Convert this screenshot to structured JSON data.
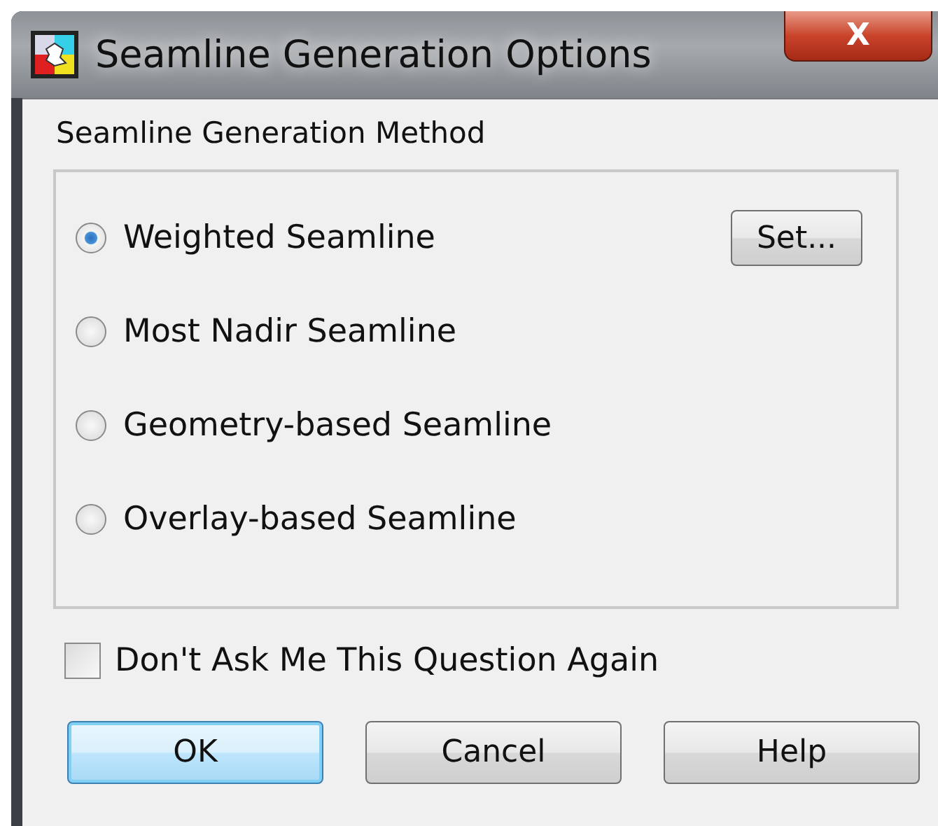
{
  "window": {
    "title": "Seamline Generation Options",
    "close_icon": "X"
  },
  "group": {
    "label": "Seamline Generation Method",
    "options": [
      {
        "label": "Weighted Seamline",
        "selected": true,
        "button": "Set..."
      },
      {
        "label": "Most Nadir Seamline",
        "selected": false
      },
      {
        "label": "Geometry-based Seamline",
        "selected": false
      },
      {
        "label": "Overlay-based Seamline",
        "selected": false
      }
    ]
  },
  "checkbox": {
    "label": "Don't Ask Me This Question Again",
    "checked": false
  },
  "buttons": [
    {
      "label": "OK",
      "default": true
    },
    {
      "label": "Cancel",
      "default": false
    },
    {
      "label": "Help",
      "default": false
    }
  ]
}
